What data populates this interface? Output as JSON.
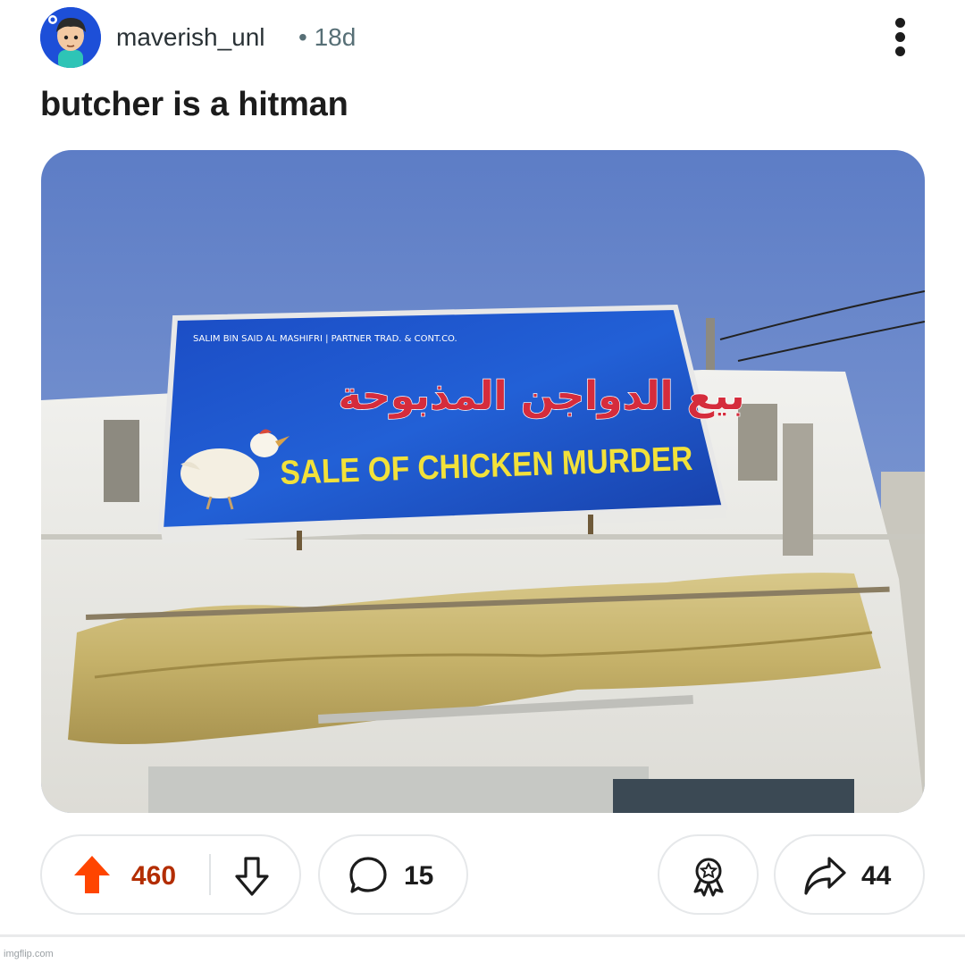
{
  "post": {
    "username": "maverish_unl",
    "age": "• 18d",
    "title": "butcher is a hitman"
  },
  "image": {
    "sign_top_line": "SALIM BIN SAID AL MASHIFRI | PARTNER TRAD. & CONT.CO.",
    "sign_arabic": "بيع الدواجن المذبوحة",
    "sign_english": "SALE OF CHICKEN MURDER"
  },
  "actions": {
    "upvotes": "460",
    "comments": "15",
    "shares": "44"
  },
  "colors": {
    "upvote_active": "#ff4500",
    "upvote_count": "#b32d00",
    "sky": "#6f8ccc",
    "sign_blue": "#1f4fbf",
    "sign_red": "#d52c3c",
    "sign_yellow": "#f2e13a"
  },
  "icons": [
    "kebab-menu-icon",
    "upvote-arrow-icon",
    "downvote-arrow-icon",
    "comment-bubble-icon",
    "award-icon",
    "share-arrow-icon"
  ],
  "watermark": "imgflip.com"
}
